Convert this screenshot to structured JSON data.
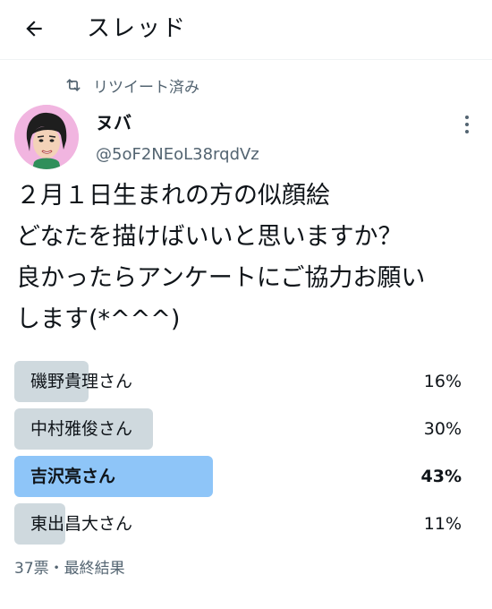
{
  "header": {
    "back_icon": "arrow-left-icon",
    "title": "スレッド"
  },
  "retweet": {
    "icon": "retweet-icon",
    "label": "リツイート済み"
  },
  "author": {
    "name": "ヌバ",
    "handle": "@5oF2NEoL38rqdVz",
    "avatar": "avatar-illustration",
    "more_icon": "more-vertical-icon"
  },
  "tweet": {
    "lines": [
      "２月１日生まれの方の似顔絵",
      "どなたを描けばいいと思いますか？",
      "良かったらアンケートにご協力お願い",
      "します(*^^^)"
    ]
  },
  "poll": {
    "options": [
      {
        "label": "磯野貴理さん",
        "percent_text": "16%",
        "percent": 16,
        "winner": false
      },
      {
        "label": "中村雅俊さん",
        "percent_text": "30%",
        "percent": 30,
        "winner": false
      },
      {
        "label": "吉沢亮さん",
        "percent_text": "43%",
        "percent": 43,
        "winner": true
      },
      {
        "label": "東出昌大さん",
        "percent_text": "11%",
        "percent": 11,
        "winner": false
      }
    ],
    "footer": "37票・最終結果"
  },
  "colors": {
    "bar_default": "#cfd9de",
    "bar_winner": "#8ec5f8",
    "text_secondary": "#536471"
  }
}
